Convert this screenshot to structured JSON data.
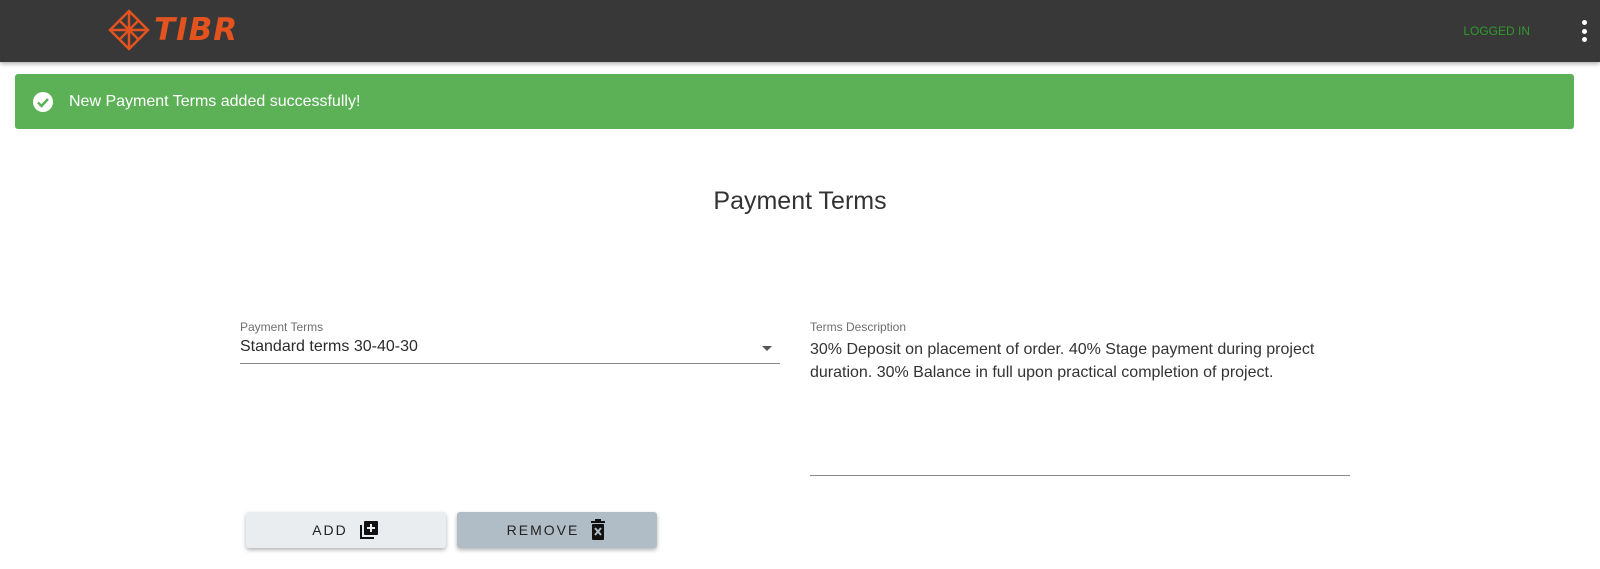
{
  "header": {
    "logo_text": "TIBR",
    "status": "LOGGED IN",
    "menu_icon": "kebab-menu-icon"
  },
  "alert": {
    "icon": "check-circle-icon",
    "message": "New Payment Terms added successfully!",
    "color": "#5cb157"
  },
  "page": {
    "title": "Payment Terms"
  },
  "form": {
    "payment_terms": {
      "label": "Payment Terms",
      "value": "Standard terms 30-40-30"
    },
    "terms_description": {
      "label": "Terms Description",
      "value": "30% Deposit on placement of order. 40% Stage payment during project duration. 30% Balance in full upon practical completion of project."
    }
  },
  "actions": {
    "add_label": "ADD",
    "add_icon": "library-add-icon",
    "remove_label": "REMOVE",
    "remove_icon": "delete-box-icon"
  },
  "colors": {
    "accent": "#e3531f",
    "topbar": "#383838",
    "success": "#5cb157"
  }
}
